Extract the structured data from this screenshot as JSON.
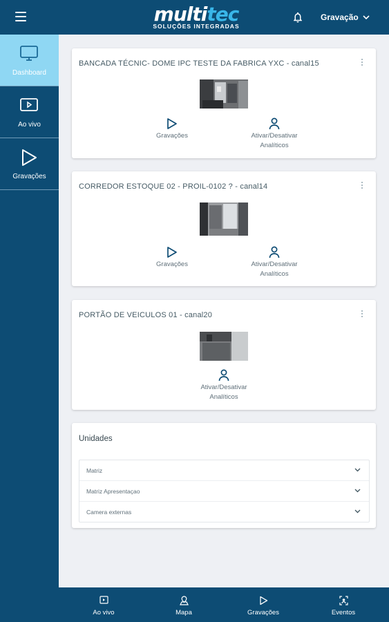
{
  "header": {
    "menu_icon": "hamburger-icon",
    "logo_main_a": "multi",
    "logo_main_b": "tec",
    "logo_sub": "SOLUÇÕES INTEGRADAS",
    "notifications_icon": "bell-icon",
    "mode_label": "Gravação"
  },
  "sidebar": {
    "items": [
      {
        "label": "Dashboard",
        "icon": "monitor-icon",
        "active": true
      },
      {
        "label": "Ao vivo",
        "icon": "live-video-icon",
        "active": false
      },
      {
        "label": "Gravações",
        "icon": "play-icon",
        "active": false
      }
    ]
  },
  "cameras": [
    {
      "title": "BANCADA TÉCNIC- DOME IPC TESTE DA FABRICA YXC - canal15",
      "actions": [
        {
          "label": "Gravações",
          "icon": "play-outline-icon"
        },
        {
          "label_line1": "Ativar/Desativar",
          "label_line2": "Analíticos",
          "icon": "person-icon"
        }
      ]
    },
    {
      "title": "CORREDOR ESTOQUE 02 - PROIL-0102 ? - canal14",
      "actions": [
        {
          "label": "Gravações",
          "icon": "play-outline-icon"
        },
        {
          "label_line1": "Ativar/Desativar",
          "label_line2": "Analíticos",
          "icon": "person-icon"
        }
      ]
    },
    {
      "title": "PORTÃO DE VEICULOS 01 - canal20",
      "actions": [
        {
          "label_line1": "Ativar/Desativar",
          "label_line2": "Analíticos",
          "icon": "person-icon"
        }
      ]
    }
  ],
  "units": {
    "title": "Unidades",
    "items": [
      "Matriz",
      "Matriz Apresentaçao",
      "Camera externas"
    ]
  },
  "bottom_nav": {
    "tabs": [
      {
        "label": "Ao vivo",
        "icon": "live-video-icon"
      },
      {
        "label": "Mapa",
        "icon": "map-pin-icon"
      },
      {
        "label": "Gravações",
        "icon": "play-icon"
      },
      {
        "label": "Eventos",
        "icon": "face-scan-icon"
      }
    ]
  },
  "colors": {
    "brand": "#0d4c74",
    "active_sidebar": "#8fd7f3",
    "logo_accent": "#39b6e8",
    "icon_blue": "#0d4c74"
  }
}
